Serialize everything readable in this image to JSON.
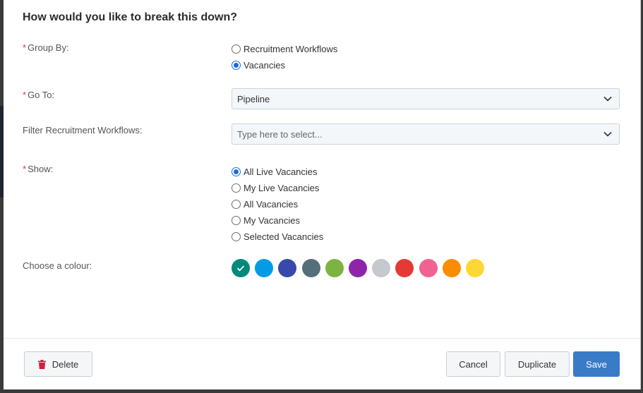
{
  "modal": {
    "title": "How would you like to break this down?"
  },
  "group_by": {
    "label": "Group By:",
    "options": [
      {
        "label": "Recruitment Workflows",
        "selected": false
      },
      {
        "label": "Vacancies",
        "selected": true
      }
    ]
  },
  "go_to": {
    "label": "Go To:",
    "value": "Pipeline"
  },
  "filter_workflows": {
    "label": "Filter Recruitment Workflows:",
    "placeholder": "Type here to select..."
  },
  "show": {
    "label": "Show:",
    "options": [
      {
        "label": "All Live Vacancies",
        "selected": true
      },
      {
        "label": "My Live Vacancies",
        "selected": false
      },
      {
        "label": "All Vacancies",
        "selected": false
      },
      {
        "label": "My Vacancies",
        "selected": false
      },
      {
        "label": "Selected Vacancies",
        "selected": false
      }
    ]
  },
  "colour": {
    "label": "Choose a colour:",
    "selected_index": 0,
    "swatches": [
      "#00897b",
      "#039be5",
      "#3949ab",
      "#546e7a",
      "#7cb342",
      "#8e24aa",
      "#c5c8cc",
      "#e53935",
      "#f06292",
      "#fb8c00",
      "#fdd835"
    ]
  },
  "footer": {
    "delete_label": "Delete",
    "cancel_label": "Cancel",
    "duplicate_label": "Duplicate",
    "save_label": "Save"
  }
}
